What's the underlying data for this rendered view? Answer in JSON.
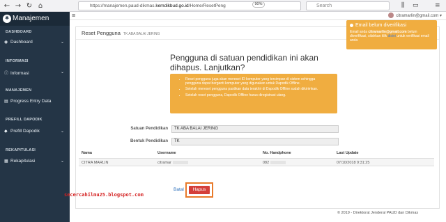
{
  "browser": {
    "url_prefix": "https://manajemen.paud-dikmas.",
    "url_domain": "kemdikbud.go.id",
    "url_path": "/Home/ResetPeng",
    "zoom": "90%",
    "search_placeholder": "Search"
  },
  "sidebar": {
    "brand": "Manajemen",
    "sections": [
      {
        "title": "DASHBOARD",
        "item": "Dashboard"
      },
      {
        "title": "INFORMASI",
        "item": "Informasi"
      },
      {
        "title": "MANAJEMEN",
        "item": "Progress Entry Data"
      },
      {
        "title": "PREFILL DAPODIK",
        "item": "Prefill Dapodik"
      },
      {
        "title": "REKAPITULASI",
        "item": "Rekapitulasi"
      }
    ]
  },
  "topbar": {
    "user": "citramarlin@gmail.com"
  },
  "panel": {
    "title": "Reset Pengguna",
    "subtitle": "TK ABA BALAI JERING",
    "question": "Pengguna di satuan pendidikan ini akan dihapus. Lanjutkan?",
    "warnings": [
      "Reset pengguna juga akan mereset ID komputer yang tersimpan di sistem sehingga pengguna dapat berganti komputer yang digunakan untuk Dapodik Offline.",
      "Setelah mereset pengguna pastikan data terakhir di Dapodik Offline sudah dikirimkan.",
      "Setelah reset pengguna, Dapodik Offline harus diregistrasi ulang."
    ],
    "fields": [
      {
        "label": "Satuan Pendidikan",
        "value": "TK ABA BALAI JERING"
      },
      {
        "label": "Bentuk Pendidikan",
        "value": "TK"
      }
    ],
    "table": {
      "headers": [
        "Nama",
        "Username",
        "No. Handphone",
        "Last Update"
      ],
      "row": [
        "CITRA MARLIN",
        "citramar",
        "082",
        "07/10/2018 9:31:25"
      ]
    },
    "batal": "Batal",
    "hapus": "Hapus"
  },
  "watermark": "secercahilmu25.blogspot.com",
  "footer": "© 2019 - Direktorat Jenderal PAUD dan Dikmas",
  "notification": {
    "title": "Email belum diverifikasi",
    "body_prefix": "Email anda",
    "email": "citramarlin@gmail.com",
    "body_mid": "belum diverifikasi, silahkan klik",
    "link": "disini",
    "body_suffix": "untuk verifikasi email anda"
  },
  "colors": {
    "sidebar": "#243546",
    "warning": "#f0ad40",
    "danger": "#d43f3a",
    "highlight": "#e87a2a"
  }
}
